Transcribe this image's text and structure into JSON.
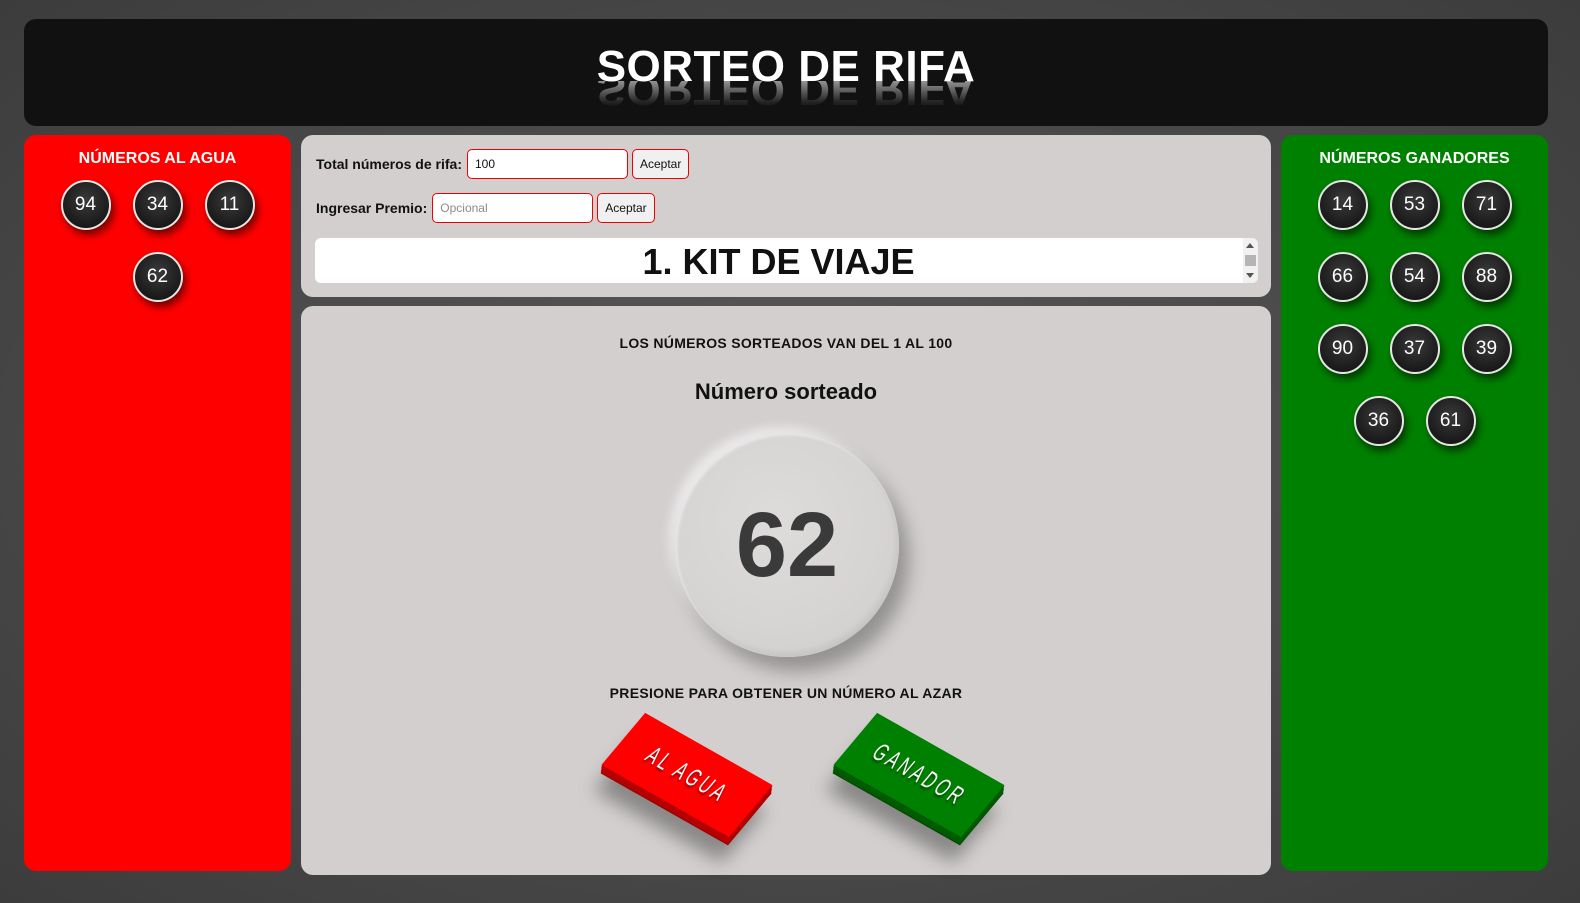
{
  "header": {
    "title": "SORTEO DE RIFA"
  },
  "losers": {
    "title": "NÚMEROS AL AGUA",
    "numbers": [
      "94",
      "34",
      "11",
      "62"
    ]
  },
  "winners": {
    "title": "NÚMEROS GANADORES",
    "numbers": [
      "14",
      "53",
      "71",
      "66",
      "54",
      "88",
      "90",
      "37",
      "39",
      "36",
      "61"
    ]
  },
  "config": {
    "total_label": "Total números de rifa:",
    "total_value": "100",
    "total_accept_label": "Aceptar",
    "prize_label": "Ingresar Premio:",
    "prize_placeholder": "Opcional",
    "prize_accept_label": "Aceptar",
    "current_prize": "1. KIT DE VIAJE"
  },
  "draw": {
    "range_text": "LOS NÚMEROS SORTEADOS VAN DEL 1 AL 100",
    "drawn_label": "Número sorteado",
    "drawn_number": "62",
    "instruction": "PRESIONE PARA OBTENER UN NÚMERO AL AZAR",
    "al_agua_label": "AL AGUA",
    "ganador_label": "GANADOR"
  },
  "colors": {
    "losers_panel": "#ff0000",
    "winners_panel": "#008000",
    "header_bg": "#111111",
    "content_bg": "#d3cfcf",
    "input_border": "#ee0000"
  },
  "icons": {
    "scroll_up": "chevron-up-icon",
    "scroll_down": "chevron-down-icon"
  }
}
